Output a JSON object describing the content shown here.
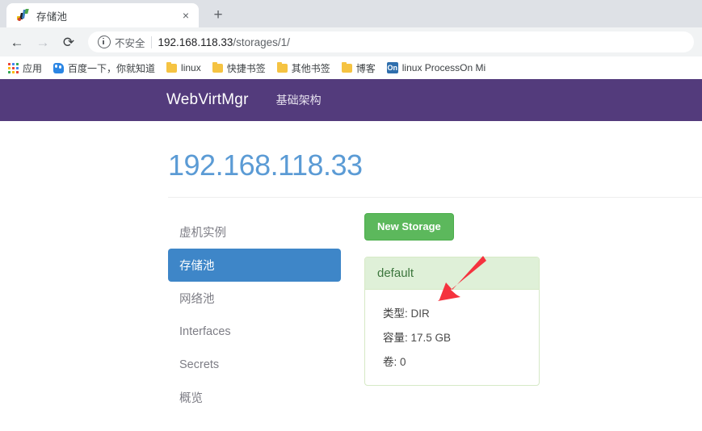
{
  "browser": {
    "tab": {
      "title": "存储池",
      "favicon_name": "webvirtmgr-favicon",
      "close_label": "×"
    },
    "new_tab_label": "+",
    "toolbar": {
      "back_label": "←",
      "forward_label": "→",
      "reload_label": "⟳",
      "security_label": "不安全",
      "url_host": "192.168.118.33",
      "url_path": "/storages/1/",
      "url_full": "192.168.118.33/storages/1/"
    },
    "bookmarks": [
      {
        "label": "应用",
        "icon": "apps-grid-icon"
      },
      {
        "label": "百度一下，你就知道",
        "icon": "baidu-icon"
      },
      {
        "label": "linux",
        "icon": "folder-icon"
      },
      {
        "label": "快捷书签",
        "icon": "folder-icon"
      },
      {
        "label": "其他书签",
        "icon": "folder-icon"
      },
      {
        "label": "博客",
        "icon": "folder-icon"
      },
      {
        "label": "linux ProcessOn Mi",
        "icon": "processon-icon",
        "icon_text": "On"
      }
    ]
  },
  "navbar": {
    "brand": "WebVirtMgr",
    "links": [
      {
        "label": "基础架构"
      }
    ]
  },
  "main": {
    "page_title": "192.168.118.33",
    "sidebar": [
      {
        "label": "虚机实例",
        "active": false
      },
      {
        "label": "存储池",
        "active": true
      },
      {
        "label": "网络池",
        "active": false
      },
      {
        "label": "Interfaces",
        "active": false
      },
      {
        "label": "Secrets",
        "active": false
      },
      {
        "label": "概览",
        "active": false
      }
    ],
    "new_storage_button": "New Storage",
    "storage_pools": [
      {
        "name": "default",
        "rows": [
          {
            "label": "类型:",
            "value": "DIR"
          },
          {
            "label": "容量:",
            "value": "17.5 GB"
          },
          {
            "label": "卷:",
            "value": "0"
          }
        ]
      }
    ]
  },
  "annotation": {
    "arrow_color": "#f5333f",
    "arrow_name": "red-pointer-arrow"
  },
  "colors": {
    "navbar_purple": "#533b7c",
    "title_blue": "#5b9bd5",
    "sidebar_active_blue": "#3e86c8",
    "button_green": "#5cb85c",
    "panel_head_green": "#dff0d8",
    "panel_border_green": "#d6e9c6",
    "panel_text_green": "#3c763d"
  }
}
